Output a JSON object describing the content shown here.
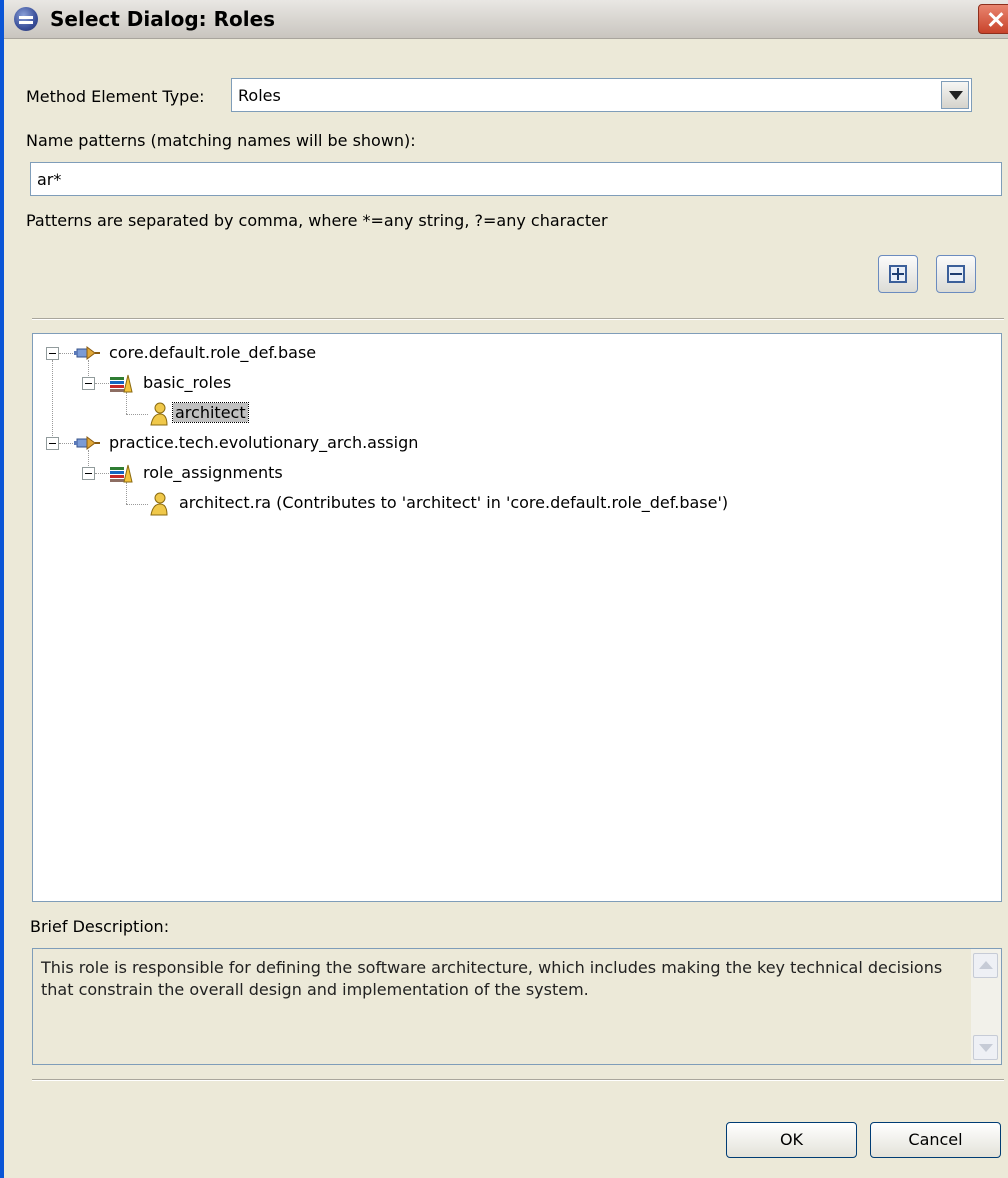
{
  "window": {
    "title": "Select Dialog: Roles"
  },
  "method_element_type": {
    "label": "Method Element Type:",
    "selected": "Roles"
  },
  "name_patterns": {
    "label": "Name patterns (matching names will be shown):",
    "value": "ar*",
    "hint": "Patterns are separated by comma, where *=any string, ?=any character"
  },
  "toolbar": {
    "expand_all_icon": "expand-all-icon",
    "collapse_all_icon": "collapse-all-icon"
  },
  "tree": {
    "nodes": [
      {
        "label": "core.default.role_def.base",
        "icon": "plugin-icon",
        "level": 0
      },
      {
        "label": "basic_roles",
        "icon": "package-icon",
        "level": 1
      },
      {
        "label": "architect",
        "icon": "role-icon",
        "level": 2,
        "selected": true
      },
      {
        "label": "practice.tech.evolutionary_arch.assign",
        "icon": "plugin-icon",
        "level": 0
      },
      {
        "label": "role_assignments",
        "icon": "package-icon",
        "level": 1
      },
      {
        "label": "architect.ra (Contributes to 'architect' in 'core.default.role_def.base')",
        "icon": "role-icon",
        "level": 2
      }
    ]
  },
  "brief_description": {
    "label": "Brief Description:",
    "text": "This role is responsible for defining the software architecture, which includes making the key technical decisions that constrain the overall design and implementation of the system."
  },
  "buttons": {
    "ok": "OK",
    "cancel": "Cancel"
  }
}
